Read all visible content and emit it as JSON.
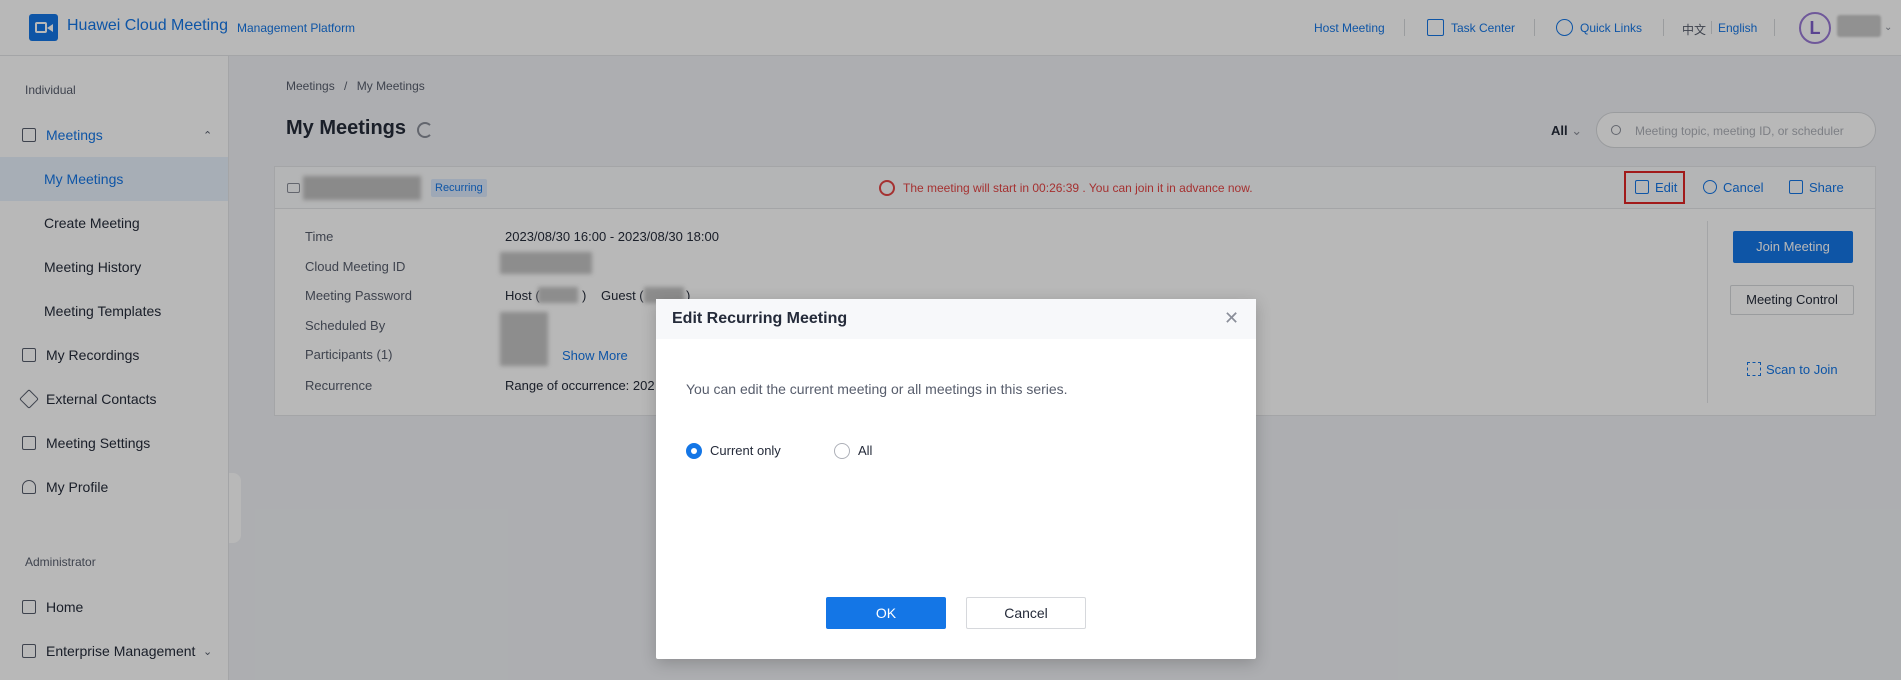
{
  "header": {
    "brand": "Huawei Cloud Meeting",
    "subtitle": "Management Platform",
    "host_meeting": "Host Meeting",
    "task_center": "Task Center",
    "quick_links": "Quick Links",
    "lang_zh": "中文",
    "lang_en": "English",
    "avatar_letter": "L"
  },
  "sidebar": {
    "group_individual": "Individual",
    "meetings": "Meetings",
    "my_meetings": "My Meetings",
    "create_meeting": "Create Meeting",
    "meeting_history": "Meeting History",
    "meeting_templates": "Meeting Templates",
    "my_recordings": "My Recordings",
    "external_contacts": "External Contacts",
    "meeting_settings": "Meeting Settings",
    "my_profile": "My Profile",
    "group_admin": "Administrator",
    "home": "Home",
    "enterprise_management": "Enterprise Management"
  },
  "main": {
    "breadcrumb_root": "Meetings",
    "breadcrumb_sep": "/",
    "breadcrumb_current": "My Meetings",
    "title": "My Meetings",
    "filter": "All",
    "search_placeholder": "Meeting topic, meeting ID, or scheduler"
  },
  "meeting": {
    "badge": "Recurring",
    "notice": "The meeting will start in 00:26:39 . You can join it in advance now.",
    "edit": "Edit",
    "cancel": "Cancel",
    "share": "Share",
    "time_label": "Time",
    "time_value": "2023/08/30 16:00 - 2023/08/30 18:00",
    "id_label": "Cloud Meeting ID",
    "password_label": "Meeting Password",
    "host_label": "Host (",
    "host_close": ")",
    "guest_label": "Guest (",
    "guest_close": ")",
    "scheduled_label": "Scheduled By",
    "participants_label": "Participants (1)",
    "show_more": "Show More",
    "recurrence_label": "Recurrence",
    "recurrence_value": "Range of occurrence: 202",
    "join": "Join Meeting",
    "control": "Meeting Control",
    "scan": "Scan to Join"
  },
  "dialog": {
    "title": "Edit Recurring Meeting",
    "message": "You can edit the current meeting or all meetings in this series.",
    "option_current": "Current only",
    "option_all": "All",
    "selected": "Current only",
    "ok": "OK",
    "cancel": "Cancel"
  }
}
